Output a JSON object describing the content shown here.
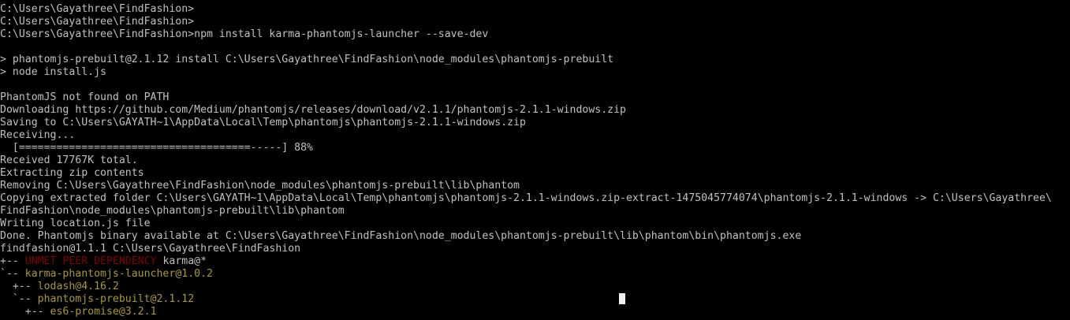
{
  "terminal": {
    "lines": [
      [
        {
          "t": "C:\\Users\\Gayathree\\FindFashion>",
          "c": "gray"
        }
      ],
      [
        {
          "t": "C:\\Users\\Gayathree\\FindFashion>",
          "c": "gray"
        }
      ],
      [
        {
          "t": "C:\\Users\\Gayathree\\FindFashion>npm install karma-phantomjs-launcher --save-dev",
          "c": "gray"
        }
      ],
      [],
      [
        {
          "t": "> phantomjs-prebuilt@2.1.12 install C:\\Users\\Gayathree\\FindFashion\\node_modules\\phantomjs-prebuilt",
          "c": "gray"
        }
      ],
      [
        {
          "t": "> node install.js",
          "c": "gray"
        }
      ],
      [],
      [
        {
          "t": "PhantomJS not found on PATH",
          "c": "gray"
        }
      ],
      [
        {
          "t": "Downloading https://github.com/Medium/phantomjs/releases/download/v2.1.1/phantomjs-2.1.1-windows.zip",
          "c": "gray"
        }
      ],
      [
        {
          "t": "Saving to C:\\Users\\GAYATH~1\\AppData\\Local\\Temp\\phantomjs\\phantomjs-2.1.1-windows.zip",
          "c": "gray"
        }
      ],
      [
        {
          "t": "Receiving...",
          "c": "gray"
        }
      ],
      [
        {
          "t": "  [=====================================-----] 88%",
          "c": "gray"
        }
      ],
      [
        {
          "t": "Received 17767K total.",
          "c": "gray"
        }
      ],
      [
        {
          "t": "Extracting zip contents",
          "c": "gray"
        }
      ],
      [
        {
          "t": "Removing C:\\Users\\Gayathree\\FindFashion\\node_modules\\phantomjs-prebuilt\\lib\\phantom",
          "c": "gray"
        }
      ],
      [
        {
          "t": "Copying extracted folder C:\\Users\\GAYATH~1\\AppData\\Local\\Temp\\phantomjs\\phantomjs-2.1.1-windows.zip-extract-1475045774074\\phantomjs-2.1.1-windows -> C:\\Users\\Gayathree\\",
          "c": "gray"
        }
      ],
      [
        {
          "t": "FindFashion\\node_modules\\phantomjs-prebuilt\\lib\\phantom",
          "c": "gray"
        }
      ],
      [
        {
          "t": "Writing location.js file",
          "c": "gray"
        }
      ],
      [
        {
          "t": "Done. Phantomjs binary available at C:\\Users\\Gayathree\\FindFashion\\node_modules\\phantomjs-prebuilt\\lib\\phantom\\bin\\phantomjs.exe",
          "c": "gray"
        }
      ],
      [
        {
          "t": "findfashion@1.1.1 C:\\Users\\Gayathree\\FindFashion",
          "c": "gray"
        }
      ],
      [
        {
          "t": "+-- ",
          "c": "gray"
        },
        {
          "t": "UNMET PEER DEPENDENCY",
          "c": "red"
        },
        {
          "t": " karma@*",
          "c": "gray"
        }
      ],
      [
        {
          "t": "`-- ",
          "c": "gray"
        },
        {
          "t": "karma-phantomjs-launcher@1.0.2",
          "c": "olive"
        }
      ],
      [
        {
          "t": "  +-- ",
          "c": "gray"
        },
        {
          "t": "lodash@4.16.2",
          "c": "olive"
        }
      ],
      [
        {
          "t": "  `-- ",
          "c": "gray"
        },
        {
          "t": "phantomjs-prebuilt@2.1.12",
          "c": "olive"
        }
      ],
      [
        {
          "t": "    +-- ",
          "c": "gray"
        },
        {
          "t": "es6-promise@3.2.1",
          "c": "olive"
        }
      ]
    ]
  },
  "colors": {
    "background": "#000000",
    "text": "#c0c0c0",
    "warning_red": "#800000",
    "package_olive": "#a89a26",
    "cursor": "#f2f2f2"
  }
}
